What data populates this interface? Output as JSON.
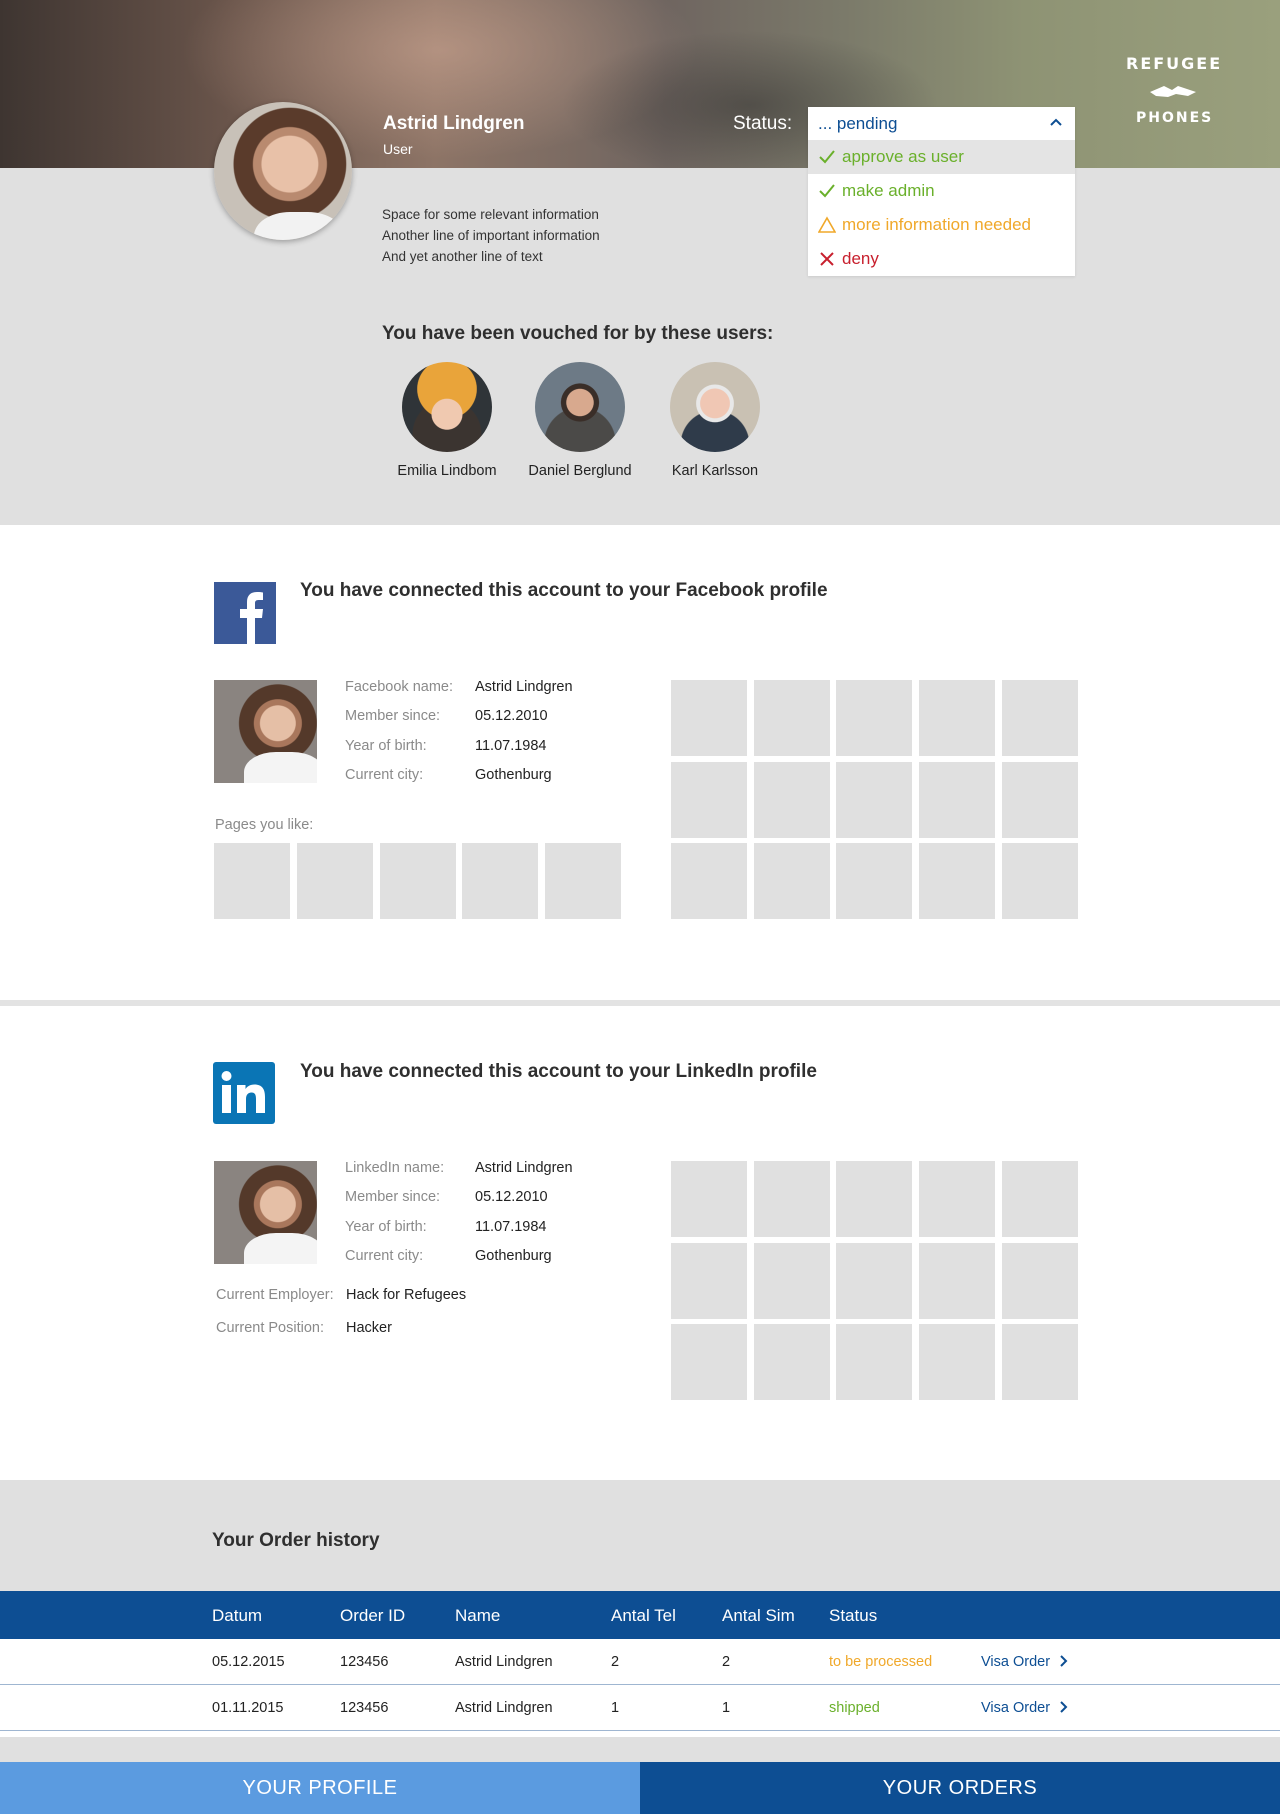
{
  "brand": {
    "logo_top": "REFUGEE",
    "logo_bottom": "PHONES"
  },
  "profile": {
    "name": "Astrid Lindgren",
    "role": "User",
    "info": [
      "Space for some relevant information",
      "Another line of important information",
      "And yet another line of text"
    ]
  },
  "status": {
    "label": "Status:",
    "current": "... pending",
    "options": [
      {
        "label": "approve as user",
        "icon": "check-icon",
        "color": "#6ab02b"
      },
      {
        "label": "make admin",
        "icon": "check-icon",
        "color": "#6ab02b"
      },
      {
        "label": "more information needed",
        "icon": "warning-icon",
        "color": "#f0a82a"
      },
      {
        "label": "deny",
        "icon": "close-icon",
        "color": "#c8202e"
      }
    ]
  },
  "vouch": {
    "title": "You have been vouched for by these users:",
    "users": [
      {
        "name": "Emilia Lindbom"
      },
      {
        "name": "Daniel Berglund"
      },
      {
        "name": "Karl Karlsson"
      }
    ]
  },
  "facebook": {
    "title": "You have connected this account to your Facebook profile",
    "fields": [
      {
        "label": "Facebook name:",
        "value": "Astrid Lindgren"
      },
      {
        "label": "Member since:",
        "value": "05.12.2010"
      },
      {
        "label": "Year of birth:",
        "value": "11.07.1984"
      },
      {
        "label": "Current city:",
        "value": "Gothenburg"
      }
    ],
    "pages_label": "Pages you like:"
  },
  "linkedin": {
    "title": "You have connected this account to your LinkedIn profile",
    "fields": [
      {
        "label": "LinkedIn name:",
        "value": "Astrid Lindgren"
      },
      {
        "label": "Member since:",
        "value": "05.12.2010"
      },
      {
        "label": "Year of birth:",
        "value": "11.07.1984"
      },
      {
        "label": "Current city:",
        "value": "Gothenburg"
      }
    ],
    "employer": {
      "label": "Current Employer:",
      "value": "Hack for Refugees"
    },
    "position": {
      "label": "Current Position:",
      "value": "Hacker"
    }
  },
  "orders": {
    "title": "Your Order history",
    "columns": [
      "Datum",
      "Order ID",
      "Name",
      "Antal Tel",
      "Antal Sim",
      "Status"
    ],
    "rows": [
      {
        "date": "05.12.2015",
        "id": "123456",
        "name": "Astrid Lindgren",
        "tel": "2",
        "sim": "2",
        "status": "to be processed",
        "status_color": "#f0a82a",
        "action": "Visa Order"
      },
      {
        "date": "01.11.2015",
        "id": "123456",
        "name": "Astrid Lindgren",
        "tel": "1",
        "sim": "1",
        "status": "shipped",
        "status_color": "#6ab02b",
        "action": "Visa Order"
      }
    ]
  },
  "nav": {
    "profile": "YOUR PROFILE",
    "orders": "YOUR ORDERS"
  },
  "colors": {
    "primary": "#0d4e93",
    "nav_active": "#5b9be0",
    "facebook": "#3b5998",
    "linkedin": "#0a75b5"
  }
}
